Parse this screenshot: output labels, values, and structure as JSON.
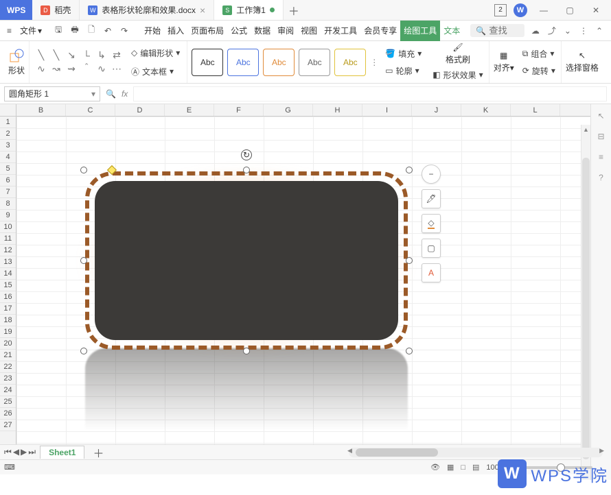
{
  "app_name": "WPS",
  "tabs": [
    {
      "icon_bg": "#ea5b45",
      "icon_text": "D",
      "label": "稻壳"
    },
    {
      "icon_bg": "#4b73df",
      "icon_text": "W",
      "label": "表格形状轮廓和效果.docx"
    },
    {
      "icon_bg": "#4ca466",
      "icon_text": "S",
      "label": "工作簿1",
      "active": true
    }
  ],
  "calendar_badge": "2",
  "file_menu_label": "文件",
  "menu": {
    "items": [
      "开始",
      "插入",
      "页面布局",
      "公式",
      "数据",
      "审阅",
      "视图",
      "开发工具",
      "会员专享",
      "绘图工具",
      "文本"
    ],
    "active_index": 9
  },
  "search_placeholder": "查找",
  "ribbon": {
    "shape_insert": "形状",
    "edit_shape": "编辑形状",
    "text_box": "文本框",
    "style_label": "Abc",
    "fill": "填充",
    "outline": "轮廓",
    "format_painter": "格式刷",
    "shape_effect": "形状效果",
    "align": "对齐",
    "group": "组合",
    "rotate": "旋转",
    "select_pane": "选择窗格"
  },
  "name_box": "圆角矩形 1",
  "columns": [
    "B",
    "C",
    "D",
    "E",
    "F",
    "G",
    "H",
    "I",
    "J",
    "K",
    "L"
  ],
  "rows": [
    "1",
    "2",
    "3",
    "4",
    "5",
    "6",
    "7",
    "8",
    "9",
    "10",
    "11",
    "12",
    "13",
    "14",
    "15",
    "16",
    "17",
    "18",
    "19",
    "20",
    "21",
    "22",
    "23",
    "24",
    "25",
    "26",
    "27"
  ],
  "sheet_name": "Sheet1",
  "zoom": "100%",
  "watermark": "WPS学院",
  "chart_data": null
}
